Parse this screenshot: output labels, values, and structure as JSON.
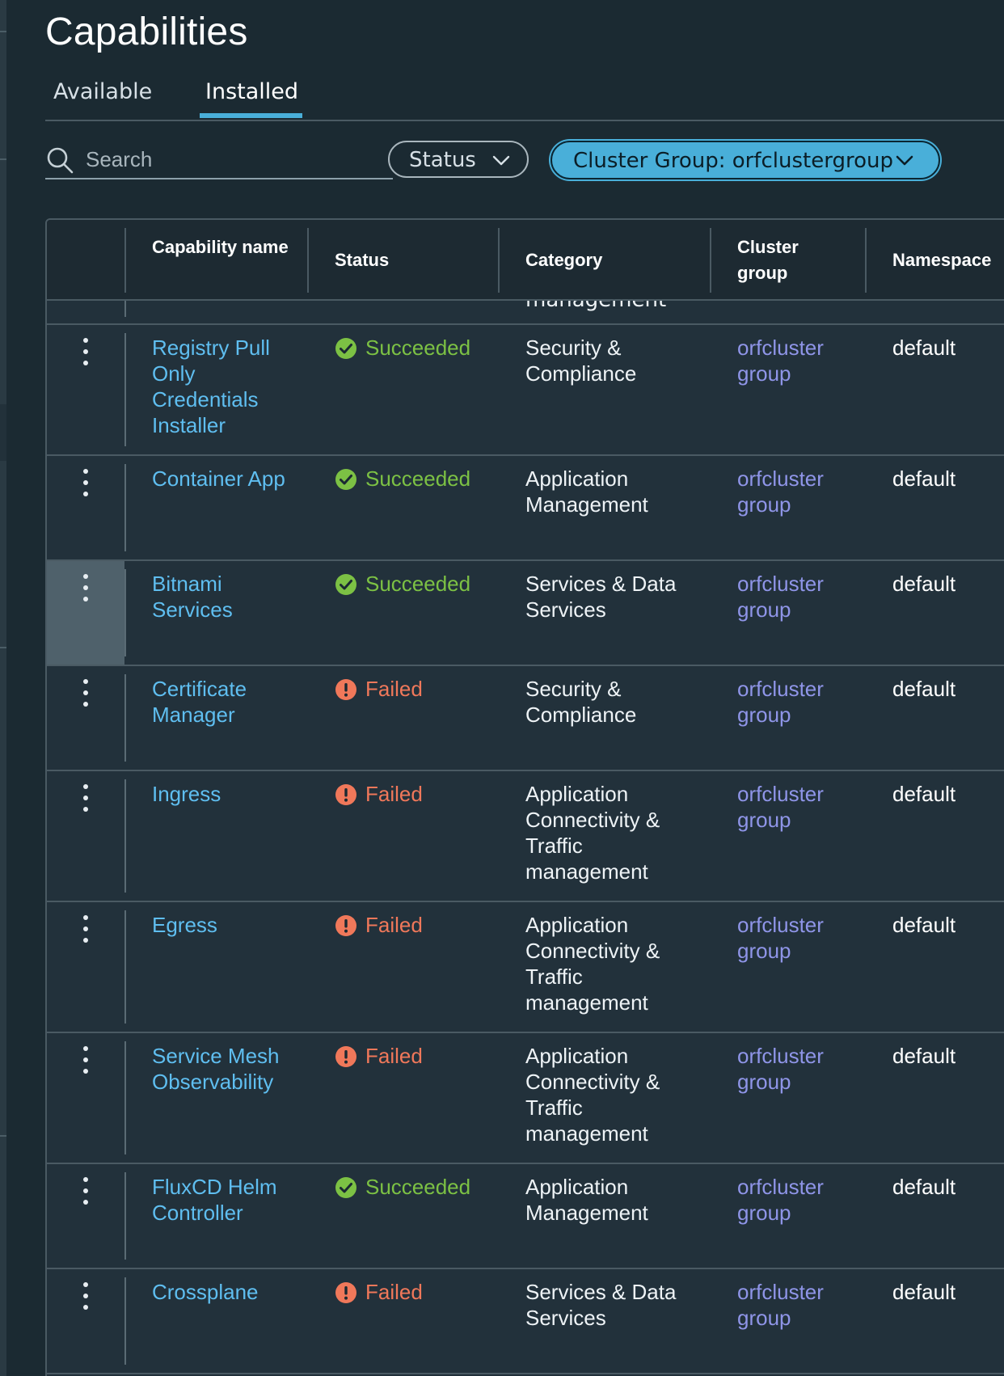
{
  "page": {
    "title": "Capabilities"
  },
  "tabs": [
    {
      "label": "Available",
      "active": false
    },
    {
      "label": "Installed",
      "active": true
    }
  ],
  "filters": {
    "search_placeholder": "Search",
    "status_label": "Status",
    "cluster_group_label": "Cluster Group: orfclustergroup"
  },
  "colors": {
    "accent": "#49afd9",
    "link": "#5fbef0",
    "cluster_link": "#8f95e8",
    "success": "#7cc144",
    "failed": "#f0785a",
    "background": "#1b2a32"
  },
  "table": {
    "headers": {
      "capability_name": "Capability name",
      "status": "Status",
      "category": "Category",
      "cluster_group": "Cluster group",
      "namespace": "Namespace"
    },
    "partial_row_fragment": "management",
    "rows": [
      {
        "name": "Registry Pull Only Credentials Installer",
        "status": "Succeeded",
        "status_kind": "success",
        "category": "Security & Compliance",
        "cluster_group": "orfcluster group",
        "namespace": "default"
      },
      {
        "name": "Container App",
        "status": "Succeeded",
        "status_kind": "success",
        "category": "Application Management",
        "cluster_group": "orfcluster group",
        "namespace": "default"
      },
      {
        "name": "Bitnami Services",
        "status": "Succeeded",
        "status_kind": "success",
        "category": "Services & Data Services",
        "cluster_group": "orfcluster group",
        "namespace": "default"
      },
      {
        "name": "Certificate Manager",
        "status": "Failed",
        "status_kind": "failed",
        "category": "Security & Compliance",
        "cluster_group": "orfcluster group",
        "namespace": "default"
      },
      {
        "name": "Ingress",
        "status": "Failed",
        "status_kind": "failed",
        "category": "Application Connectivity & Traffic management",
        "cluster_group": "orfcluster group",
        "namespace": "default"
      },
      {
        "name": "Egress",
        "status": "Failed",
        "status_kind": "failed",
        "category": "Application Connectivity & Traffic management",
        "cluster_group": "orfcluster group",
        "namespace": "default"
      },
      {
        "name": "Service Mesh Observability",
        "status": "Failed",
        "status_kind": "failed",
        "category": "Application Connectivity & Traffic management",
        "cluster_group": "orfcluster group",
        "namespace": "default"
      },
      {
        "name": "FluxCD Helm Controller",
        "status": "Succeeded",
        "status_kind": "success",
        "category": "Application Management",
        "cluster_group": "orfcluster group",
        "namespace": "default"
      },
      {
        "name": "Crossplane",
        "status": "Failed",
        "status_kind": "failed",
        "category": "Services & Data Services",
        "cluster_group": "orfcluster group",
        "namespace": "default"
      }
    ],
    "hovered_row_index": 2,
    "icons": {
      "row_actions": "kebab-menu-icon",
      "success": "check-circle-icon",
      "failed": "exclamation-circle-icon",
      "search": "search-icon",
      "dropdown": "chevron-down-icon"
    }
  }
}
